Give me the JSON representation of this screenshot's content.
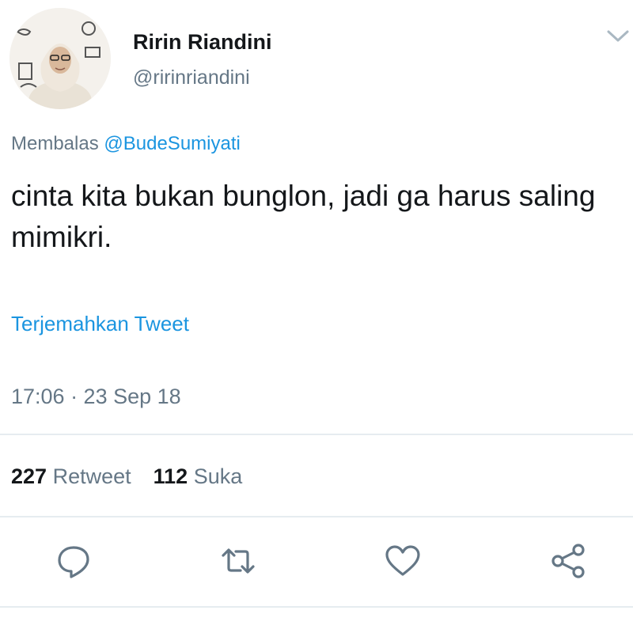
{
  "tweet": {
    "author_name": "Ririn Riandini",
    "author_handle": "@ririnriandini",
    "reply_prefix": "Membalas",
    "reply_to": "@BudeSumiyati",
    "text": "cinta kita bukan bunglon, jadi ga harus saling mimikri.",
    "translate_label": "Terjemahkan Tweet",
    "timestamp": "17:06 · 23 Sep 18"
  },
  "stats": {
    "retweet_count": "227",
    "retweet_label": "Retweet",
    "like_count": "112",
    "like_label": "Suka"
  },
  "actions": [
    {
      "icon": "reply-icon"
    },
    {
      "icon": "retweet-icon"
    },
    {
      "icon": "heart-icon"
    },
    {
      "icon": "share-icon"
    }
  ],
  "colors": {
    "link": "#1b95e0",
    "secondary_text": "#657786",
    "primary_text": "#14171a",
    "divider": "#e6ecf0"
  }
}
